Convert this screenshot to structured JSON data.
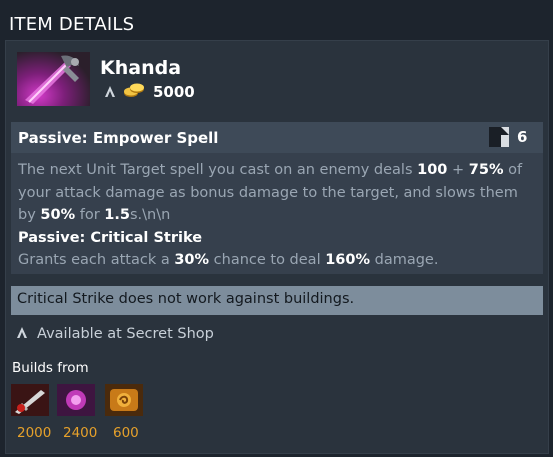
{
  "header": {
    "title": "ITEM DETAILS"
  },
  "item": {
    "name": "Khanda",
    "cost": "5000",
    "icon": "khanda-item-icon"
  },
  "ability": {
    "title": "Passive: Empower Spell",
    "cooldown": "6",
    "desc": {
      "p1": "The next Unit Target spell you cast on an enemy deals ",
      "v1": "100",
      "p2": " + ",
      "v2": "75%",
      "p3": " of your attack damage as bonus damage to the target, and slows them by ",
      "v3": "50%",
      "p4": " for ",
      "v4": "1.5",
      "p5": "s.\\n\\n"
    },
    "sub_title": "Passive: Critical Strike",
    "sub_desc": {
      "p1": "Grants each attack a ",
      "v1": "30%",
      "p2": " chance to deal ",
      "v2": "160%",
      "p3": " damage."
    }
  },
  "note": "Critical Strike does not work against buildings.",
  "availability": "Available at Secret Shop",
  "builds": {
    "label": "Builds from",
    "components": [
      {
        "icon": "sword-component-icon",
        "price": "2000"
      },
      {
        "icon": "magic-orb-component-icon",
        "price": "2400"
      },
      {
        "icon": "golden-scroll-component-icon",
        "price": "600"
      }
    ]
  },
  "colors": {
    "background": "#1d242d",
    "panel": "#2a333d",
    "price_gold": "#e6a12b",
    "note_bar": "#7d8d9c"
  }
}
